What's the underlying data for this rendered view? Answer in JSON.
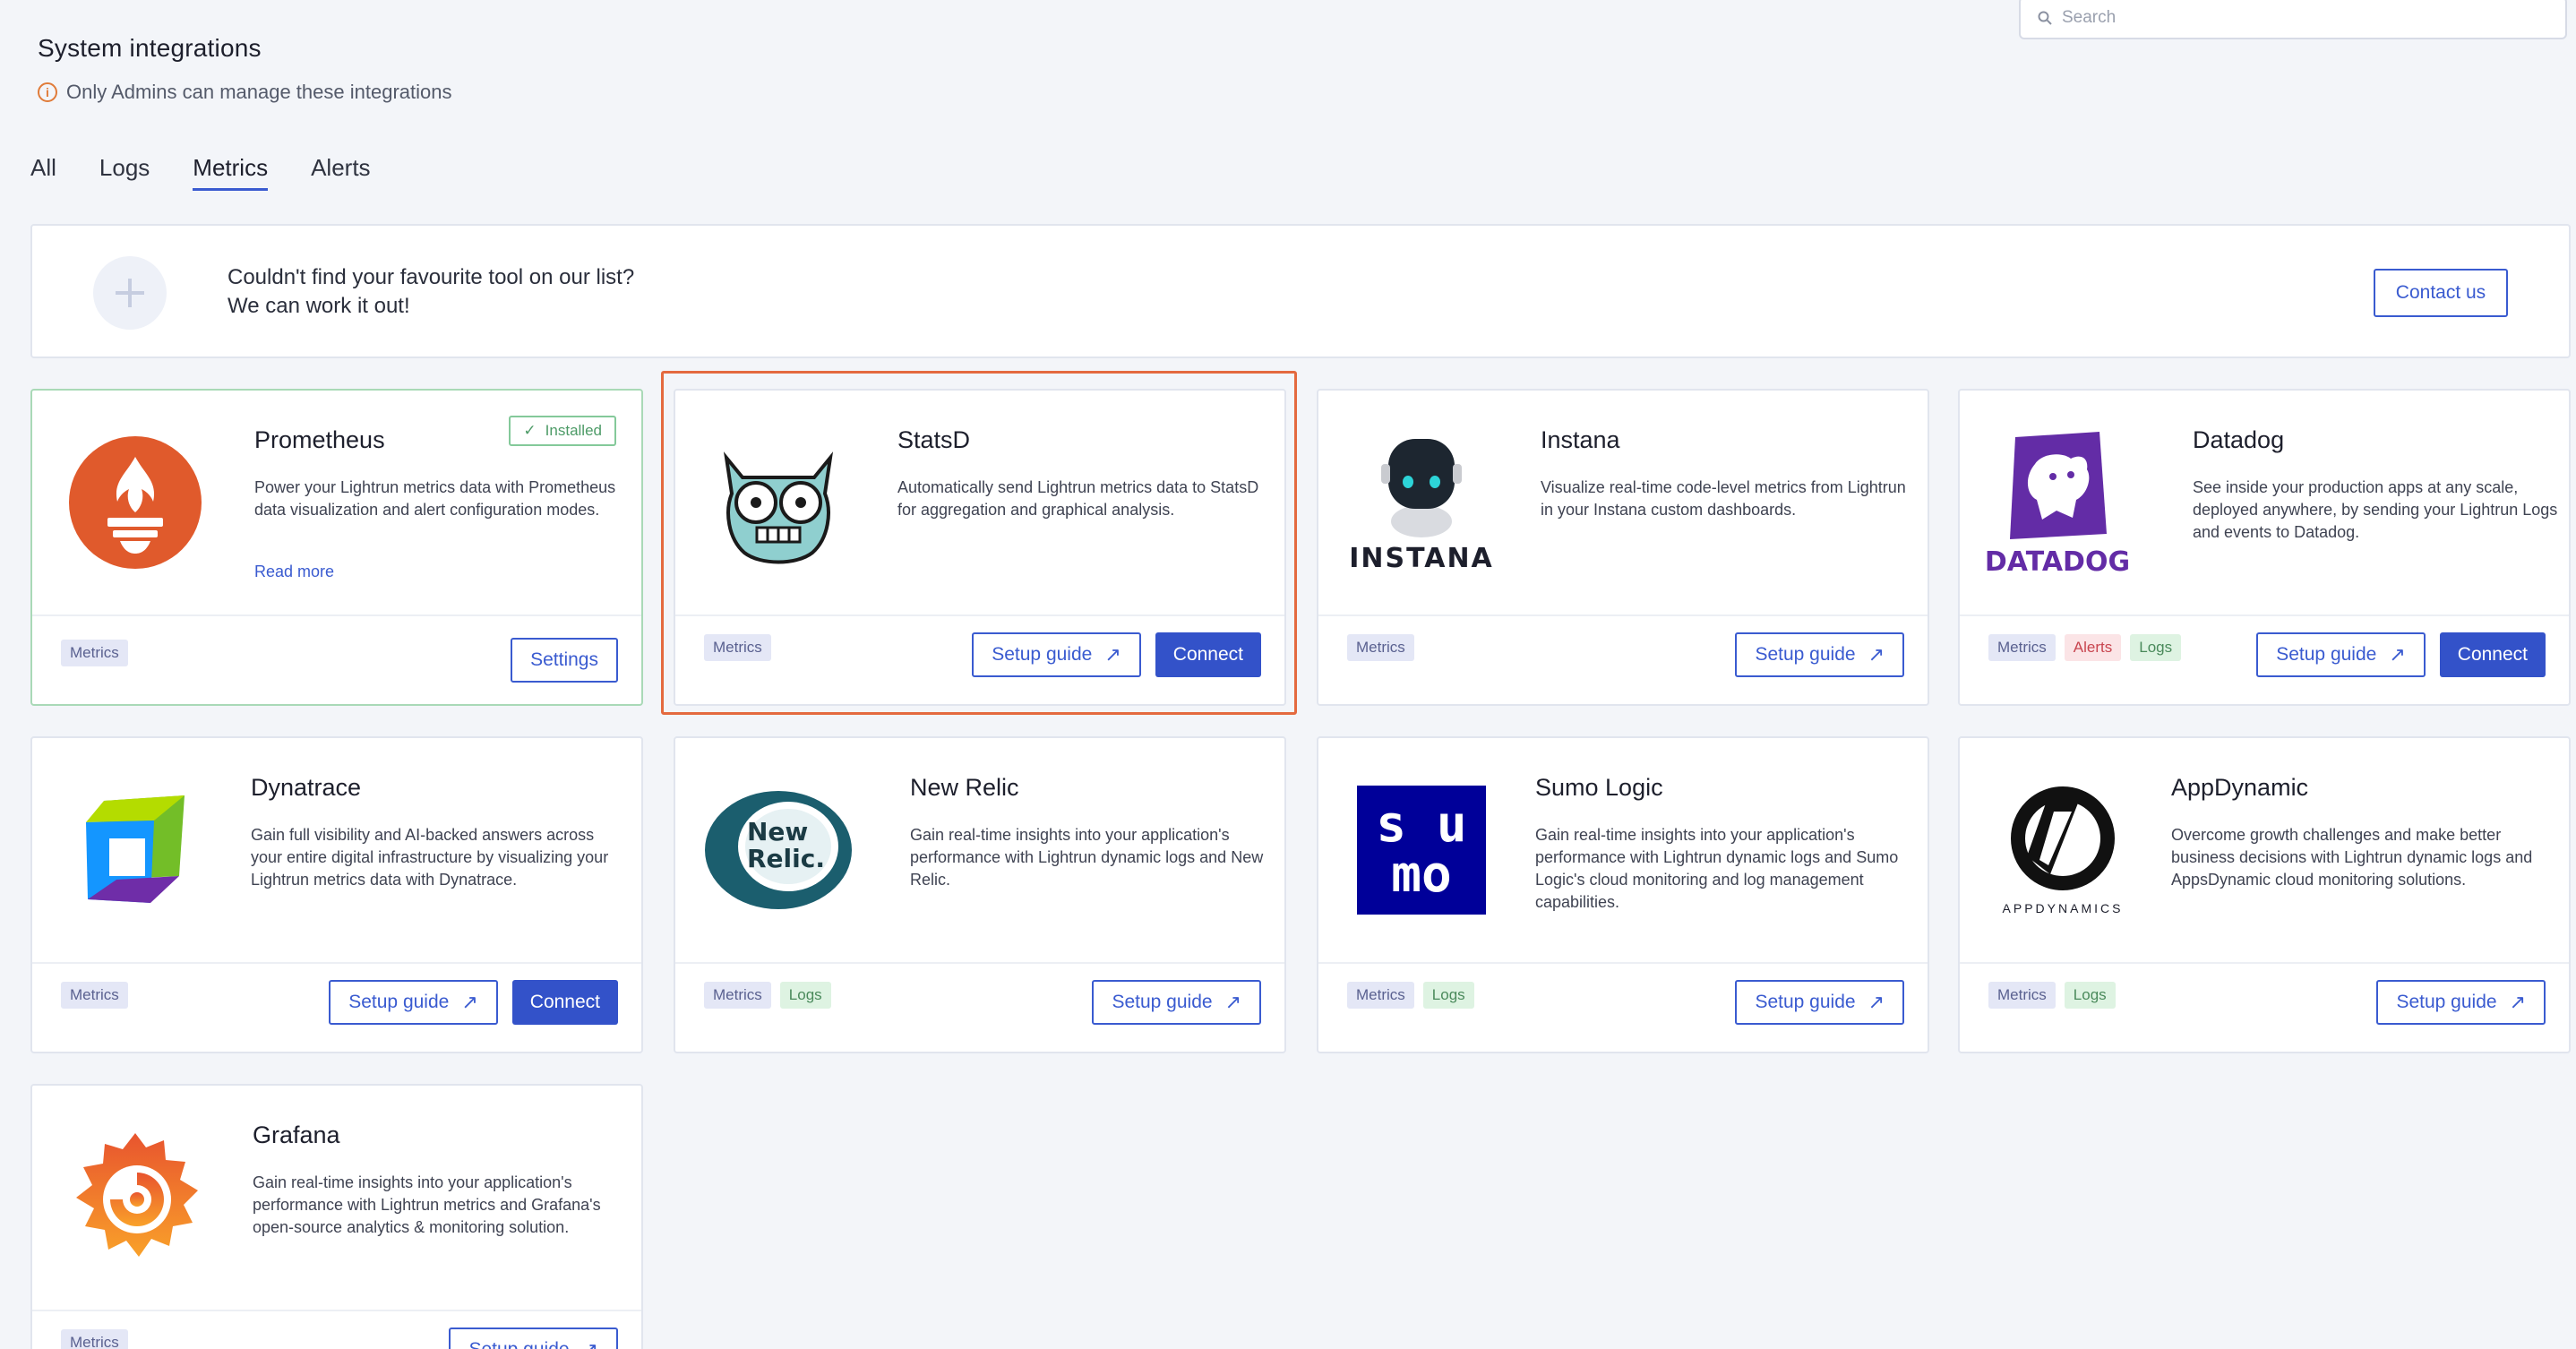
{
  "header": {
    "title": "System integrations",
    "admin_note": "Only Admins can manage these integrations",
    "search_placeholder": "Search"
  },
  "tabs": [
    {
      "label": "All",
      "active": false
    },
    {
      "label": "Logs",
      "active": false
    },
    {
      "label": "Metrics",
      "active": true
    },
    {
      "label": "Alerts",
      "active": false
    }
  ],
  "banner": {
    "line1": "Couldn't find your favourite tool on our list?",
    "line2": "We can work it out!",
    "contact_label": "Contact us"
  },
  "cards": [
    {
      "name": "Prometheus",
      "description": "Power your Lightrun metrics data with Prometheus data visualization and alert configuration modes.",
      "read_more": "Read more",
      "installed_label": "Installed",
      "tags": [
        "Metrics"
      ],
      "settings_label": "Settings"
    },
    {
      "name": "StatsD",
      "description": "Automatically send Lightrun metrics data to StatsD for aggregation and graphical analysis.",
      "tags": [
        "Metrics"
      ],
      "setup_label": "Setup guide",
      "connect_label": "Connect"
    },
    {
      "name": "Instana",
      "description": "Visualize real-time code-level metrics from Lightrun in your Instana custom dashboards.",
      "logo_text": "INSTANA",
      "tags": [
        "Metrics"
      ],
      "setup_label": "Setup guide"
    },
    {
      "name": "Datadog",
      "description": "See inside your production apps at any scale, deployed anywhere, by sending your Lightrun Logs and events to Datadog.",
      "logo_text": "DATADOG",
      "tags": [
        "Metrics",
        "Alerts",
        "Logs"
      ],
      "setup_label": "Setup guide",
      "connect_label": "Connect"
    },
    {
      "name": "Dynatrace",
      "description": "Gain full visibility and AI-backed answers across your entire digital infrastructure by visualizing your Lightrun metrics data with Dynatrace.",
      "tags": [
        "Metrics"
      ],
      "setup_label": "Setup guide",
      "connect_label": "Connect"
    },
    {
      "name": "New Relic",
      "description": "Gain real-time insights into your application's performance with Lightrun dynamic logs and New Relic.",
      "logo_text_1": "New",
      "logo_text_2": "Relic.",
      "tags": [
        "Metrics",
        "Logs"
      ],
      "setup_label": "Setup guide"
    },
    {
      "name": "Sumo Logic",
      "description": "Gain real-time insights into your application's performance with Lightrun dynamic logs and Sumo Logic's cloud monitoring and log management capabilities.",
      "logo_text_1": "s u",
      "logo_text_2": "mo",
      "tags": [
        "Metrics",
        "Logs"
      ],
      "setup_label": "Setup guide"
    },
    {
      "name": "AppDynamic",
      "description": "Overcome growth challenges and make better business decisions with Lightrun dynamic logs and AppsDynamic cloud monitoring solutions.",
      "logo_text": "APPDYNAMICS",
      "tags": [
        "Metrics",
        "Logs"
      ],
      "setup_label": "Setup guide"
    },
    {
      "name": "Grafana",
      "description": "Gain real-time insights into your application's performance with Lightrun metrics and Grafana's open-source analytics & monitoring solution.",
      "tags": [
        "Metrics"
      ],
      "setup_label": "Setup guide"
    }
  ],
  "colors": {
    "accent": "#3352c9",
    "highlight": "#e46a3f",
    "installed": "#84c99a"
  }
}
